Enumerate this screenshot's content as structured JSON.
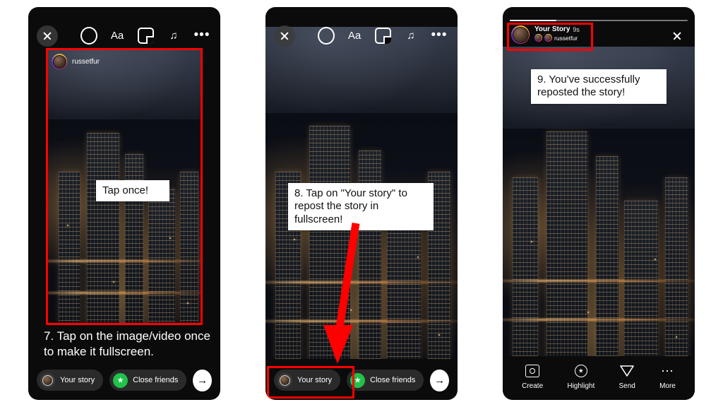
{
  "panels": [
    {
      "id": "panel-1",
      "topbar": {
        "close_icon": "close-icon",
        "tools": [
          {
            "name": "circle-tool-icon",
            "label": ""
          },
          {
            "name": "text-tool-icon",
            "label": "Aa"
          },
          {
            "name": "sticker-tool-icon",
            "label": ""
          },
          {
            "name": "music-tool-icon",
            "label": "♫"
          },
          {
            "name": "more-tool-icon",
            "label": "•••"
          }
        ]
      },
      "story": {
        "username": "russetfur"
      },
      "callout": "Tap once!",
      "caption": "7. Tap on the image/video once to make it fullscreen.",
      "bottom": {
        "your_story": "Your story",
        "close_friends": "Close friends",
        "send_arrow": "→"
      }
    },
    {
      "id": "panel-2",
      "topbar": {
        "close_icon": "close-icon",
        "tools": [
          {
            "name": "circle-tool-icon",
            "label": ""
          },
          {
            "name": "text-tool-icon",
            "label": "Aa"
          },
          {
            "name": "sticker-tool-icon",
            "label": ""
          },
          {
            "name": "music-tool-icon",
            "label": "♫"
          },
          {
            "name": "more-tool-icon",
            "label": "•••"
          }
        ]
      },
      "callout": "8. Tap on \"Your story\" to repost the story in fullscreen!",
      "bottom": {
        "your_story": "Your story",
        "close_friends": "Close friends",
        "send_arrow": "→"
      }
    },
    {
      "id": "panel-3",
      "header": {
        "title": "Your Story",
        "time": "9s",
        "reposted_from": "russetfur"
      },
      "close_icon": "close-icon",
      "callout": "9. You've successfully reposted the story!",
      "bottom_actions": [
        {
          "name": "create-action",
          "label": "Create"
        },
        {
          "name": "highlight-action",
          "label": "Highlight"
        },
        {
          "name": "send-action",
          "label": "Send"
        },
        {
          "name": "more-action",
          "label": "More"
        }
      ]
    }
  ],
  "colors": {
    "annotation": "#ff0000",
    "callout_bg": "#ffffff",
    "phone_bg": "#0b0b0b",
    "close_friends_green": "#20c24a"
  }
}
